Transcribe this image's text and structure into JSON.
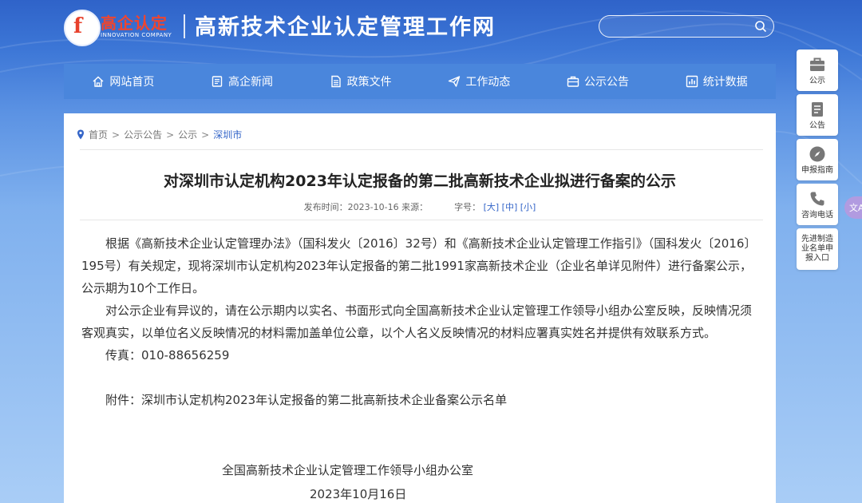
{
  "header": {
    "logo_text": "高企认定",
    "logo_sub": "INNOVATION COMPANY",
    "logo_mark": "f",
    "site_title": "高新技术企业认定管理工作网",
    "search_placeholder": ""
  },
  "nav": {
    "items": [
      {
        "label": "网站首页",
        "icon": "home-icon"
      },
      {
        "label": "高企新闻",
        "icon": "news-icon"
      },
      {
        "label": "政策文件",
        "icon": "document-icon"
      },
      {
        "label": "工作动态",
        "icon": "send-icon"
      },
      {
        "label": "公示公告",
        "icon": "briefcase-icon"
      },
      {
        "label": "统计数据",
        "icon": "chart-icon"
      }
    ]
  },
  "breadcrumb": {
    "items": [
      "首页",
      "公示公告",
      "公示"
    ],
    "current": "深圳市",
    "sep": ">"
  },
  "article": {
    "title": "对深圳市认定机构2023年认定报备的第二批高新技术企业拟进行备案的公示",
    "meta_time": "发布时间：2023-10-16 来源：",
    "meta_font_label": "字号：",
    "font_large": "[大]",
    "font_medium": "[中]",
    "font_small": "[小]",
    "para1": "根据《高新技术企业认定管理办法》（国科发火〔2016〕32号）和《高新技术企业认定管理工作指引》（国科发火〔2016〕195号）有关规定，现将深圳市认定机构2023年认定报备的第二批1991家高新技术企业（企业名单详见附件）进行备案公示，公示期为10个工作日。",
    "para2": "对公示企业有异议的，请在公示期内以实名、书面形式向全国高新技术企业认定管理工作领导小组办公室反映，反映情况须客观真实，以单位名义反映情况的材料需加盖单位公章，以个人名义反映情况的材料应署真实姓名并提供有效联系方式。",
    "fax": "传真：010-88656259",
    "attachment": "附件：深圳市认定机构2023年认定报备的第二批高新技术企业备案公示名单",
    "sign_org": "全国高新技术企业认定管理工作领导小组办公室",
    "sign_date": "2023年10月16日"
  },
  "sidebar": {
    "buttons": [
      {
        "label": "公示",
        "icon": "briefcase-icon"
      },
      {
        "label": "公告",
        "icon": "notice-icon"
      },
      {
        "label": "申报指南",
        "icon": "compass-icon"
      },
      {
        "label": "咨询电话",
        "icon": "phone-icon"
      }
    ],
    "entry_label": "先进制造业名单申报入口"
  },
  "edge_tab": "文A",
  "colors": {
    "nav_bg": "#4a86dc",
    "link": "#3465c8",
    "logo_red": "#f0452e"
  }
}
